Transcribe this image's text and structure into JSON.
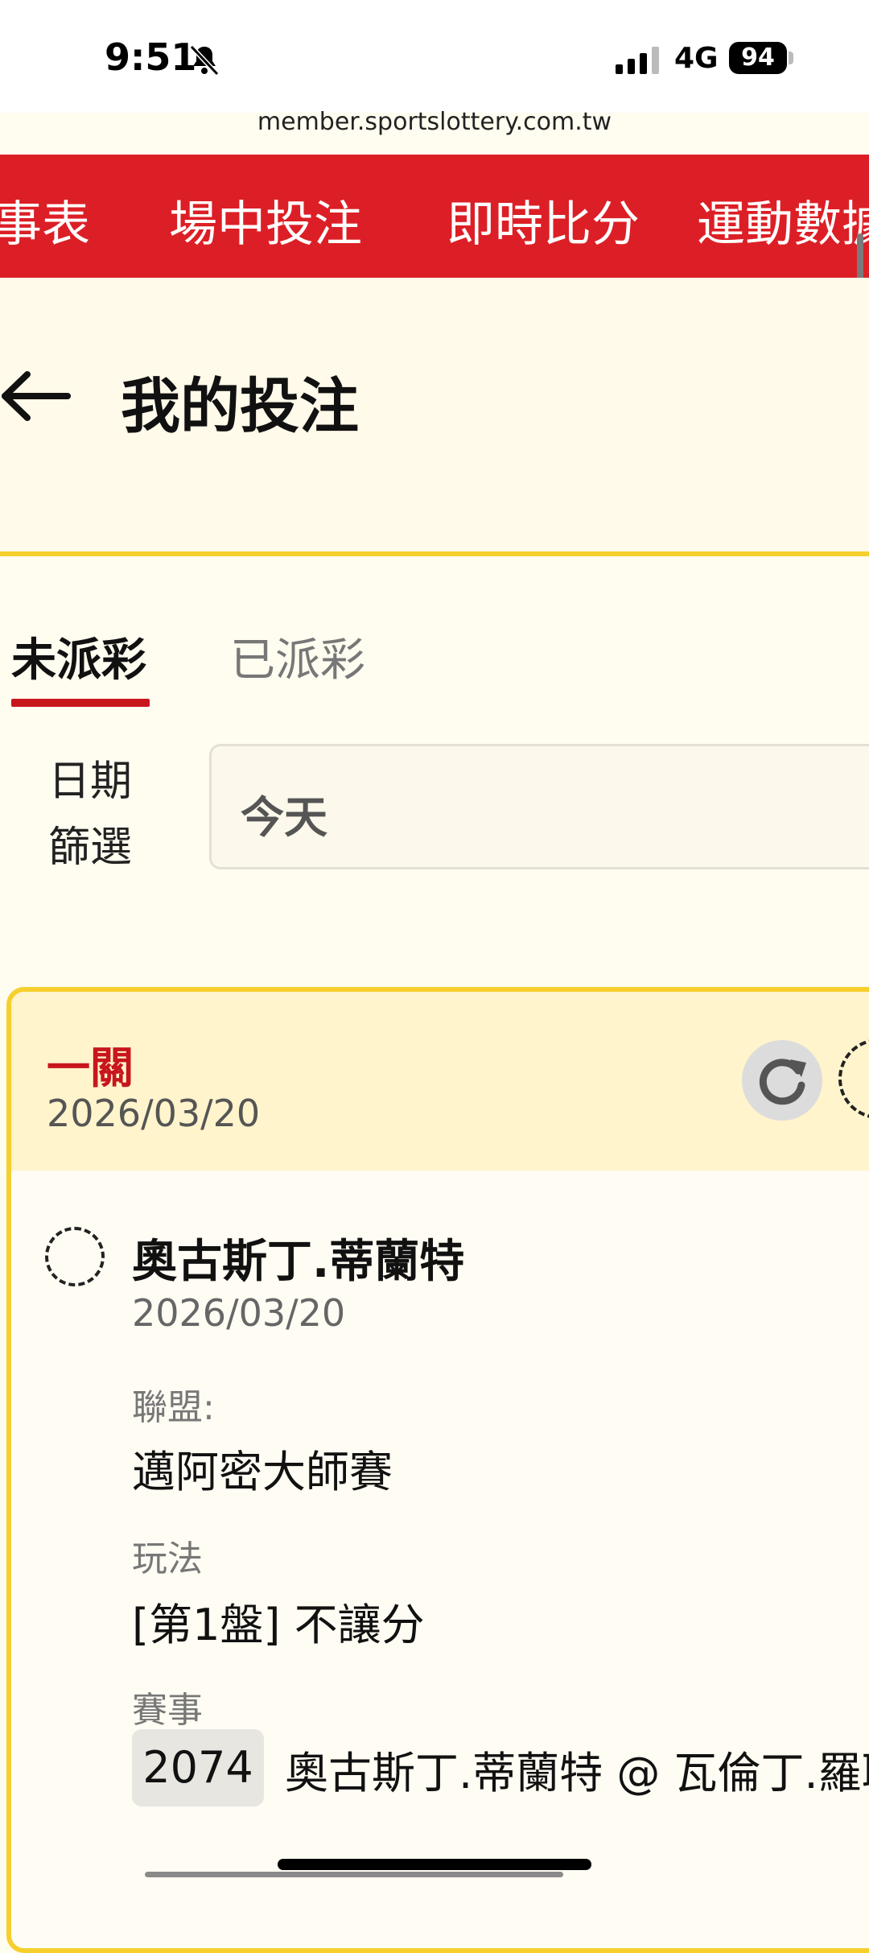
{
  "status_bar": {
    "time": "9:51",
    "network": "4G",
    "battery": "94"
  },
  "browser": {
    "url": "member.sportslottery.com.tw"
  },
  "top_nav": {
    "items": [
      "事表",
      "場中投注",
      "即時比分",
      "運動數據"
    ]
  },
  "page": {
    "title": "我的投注"
  },
  "tabs": {
    "active": "未派彩",
    "inactive": "已派彩"
  },
  "filter": {
    "label": "日期篩選",
    "value": "今天"
  },
  "bet_card": {
    "type": "一關",
    "date": "2026/03/20",
    "selection": {
      "player": "奧古斯丁.蒂蘭特",
      "date": "2026/03/20",
      "league_label": "聯盟:",
      "league": "邁阿密大師賽",
      "play_label": "玩法",
      "play": "[第1盤] 不讓分",
      "match_label": "賽事",
      "match_code": "2074",
      "match_name": "奧古斯丁.蒂蘭特 @ 瓦倫丁.羅耶"
    }
  },
  "colors": {
    "brand_red": "#dc1f26",
    "accent_yellow": "#f6cf2d",
    "card_head": "#fff4cc"
  }
}
